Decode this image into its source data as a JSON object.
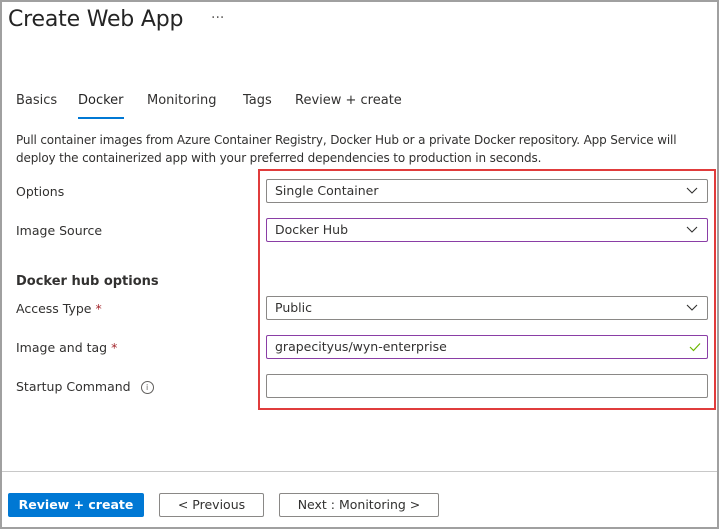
{
  "header": {
    "title": "Create Web App",
    "more_label": "···"
  },
  "tabs": [
    {
      "label": "Basics",
      "active": false
    },
    {
      "label": "Docker",
      "active": true
    },
    {
      "label": "Monitoring",
      "active": false
    },
    {
      "label": "Tags",
      "active": false
    },
    {
      "label": "Review + create",
      "active": false
    }
  ],
  "description": "Pull container images from Azure Container Registry, Docker Hub or a private Docker repository. App Service will deploy the containerized app with your preferred dependencies to production in seconds.",
  "form": {
    "options": {
      "label": "Options",
      "value": "Single Container"
    },
    "image_source": {
      "label": "Image Source",
      "value": "Docker Hub"
    },
    "section_title": "Docker hub options",
    "access_type": {
      "label": "Access Type",
      "required": "*",
      "value": "Public"
    },
    "image_and_tag": {
      "label": "Image and tag",
      "required": "*",
      "value": "grapecityus/wyn-enterprise"
    },
    "startup_command": {
      "label": "Startup Command",
      "info": "i",
      "value": ""
    }
  },
  "footer": {
    "review_create": "Review + create",
    "previous": "< Previous",
    "next": "Next : Monitoring >"
  },
  "colors": {
    "accent": "#0078d4",
    "focus_border": "#8a3ea6",
    "highlight_box": "#e03c3c",
    "valid_check": "#6bb700",
    "required": "#a4262c"
  }
}
